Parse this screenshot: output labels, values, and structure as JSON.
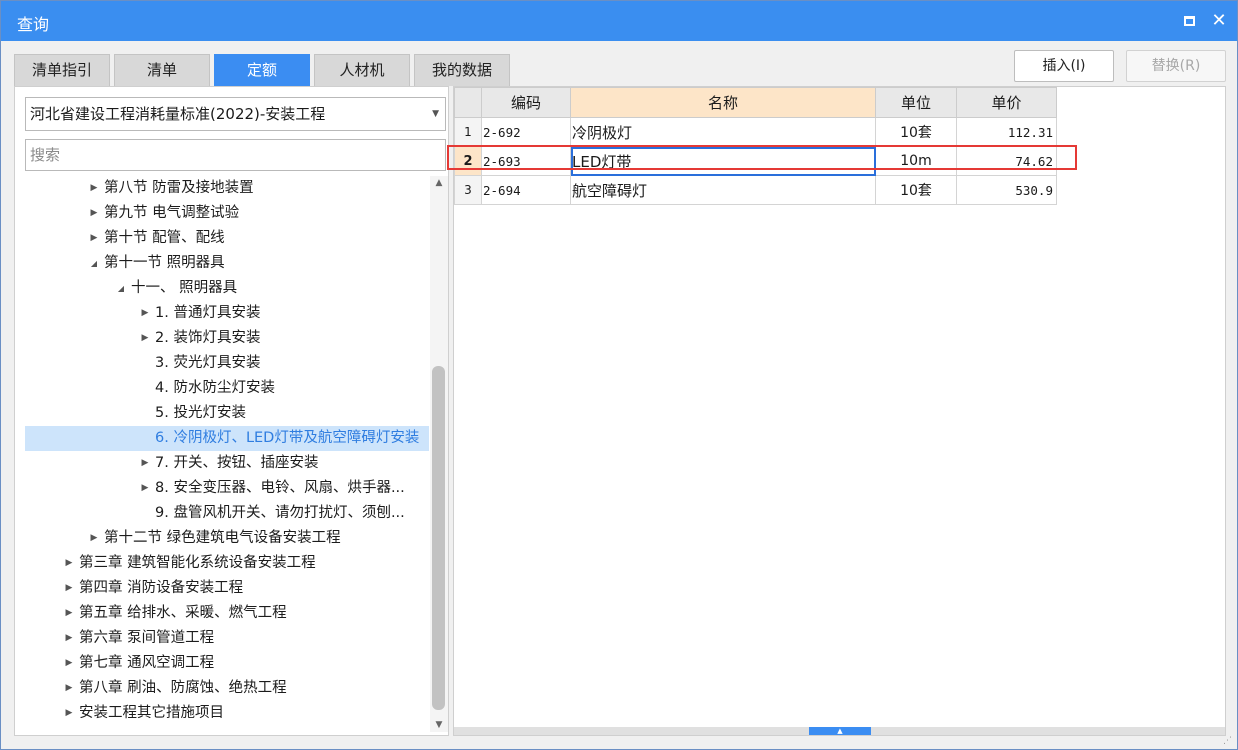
{
  "window": {
    "title": "查询"
  },
  "tabs": [
    {
      "label": "清单指引",
      "active": false
    },
    {
      "label": "清单",
      "active": false
    },
    {
      "label": "定额",
      "active": true
    },
    {
      "label": "人材机",
      "active": false
    },
    {
      "label": "我的数据",
      "active": false
    }
  ],
  "buttons": {
    "insert": "插入(I)",
    "replace": "替换(R)"
  },
  "left": {
    "dropdown_value": "河北省建设工程消耗量标准(2022)-安装工程",
    "search_placeholder": "搜索"
  },
  "tree": [
    {
      "label": "第八节 防雷及接地装置",
      "level": 2,
      "state": "collapsed"
    },
    {
      "label": "第九节 电气调整试验",
      "level": 2,
      "state": "collapsed"
    },
    {
      "label": "第十节 配管、配线",
      "level": 2,
      "state": "collapsed"
    },
    {
      "label": "第十一节 照明器具",
      "level": 2,
      "state": "expanded"
    },
    {
      "label": "十一、 照明器具",
      "level": 3,
      "state": "expanded"
    },
    {
      "label": "1. 普通灯具安装",
      "level": 4,
      "state": "collapsed"
    },
    {
      "label": "2. 装饰灯具安装",
      "level": 4,
      "state": "collapsed"
    },
    {
      "label": "3. 荧光灯具安装",
      "level": 4,
      "state": "leaf"
    },
    {
      "label": "4. 防水防尘灯安装",
      "level": 4,
      "state": "leaf"
    },
    {
      "label": "5. 投光灯安装",
      "level": 4,
      "state": "leaf"
    },
    {
      "label": "6. 冷阴极灯、LED灯带及航空障碍灯安装",
      "level": 4,
      "state": "leaf",
      "selected": true
    },
    {
      "label": "7. 开关、按钮、插座安装",
      "level": 4,
      "state": "collapsed"
    },
    {
      "label": "8. 安全变压器、电铃、风扇、烘手器...",
      "level": 4,
      "state": "collapsed"
    },
    {
      "label": "9. 盘管风机开关、请勿打扰灯、须刨...",
      "level": 4,
      "state": "leaf"
    },
    {
      "label": "第十二节 绿色建筑电气设备安装工程",
      "level": 2,
      "state": "collapsed"
    },
    {
      "label": "第三章 建筑智能化系统设备安装工程",
      "level": 1,
      "state": "collapsed"
    },
    {
      "label": "第四章 消防设备安装工程",
      "level": 1,
      "state": "collapsed"
    },
    {
      "label": "第五章 给排水、采暖、燃气工程",
      "level": 1,
      "state": "collapsed"
    },
    {
      "label": "第六章 泵间管道工程",
      "level": 1,
      "state": "collapsed"
    },
    {
      "label": "第七章 通风空调工程",
      "level": 1,
      "state": "collapsed"
    },
    {
      "label": "第八章 刷油、防腐蚀、绝热工程",
      "level": 1,
      "state": "collapsed"
    },
    {
      "label": "安装工程其它措施项目",
      "level": 1,
      "state": "collapsed"
    }
  ],
  "grid": {
    "headers": {
      "code": "编码",
      "name": "名称",
      "unit": "单位",
      "price": "单价"
    },
    "rows": [
      {
        "num": "1",
        "code": "2-692",
        "name": "冷阴极灯",
        "unit": "10套",
        "price": "112.31"
      },
      {
        "num": "2",
        "code": "2-693",
        "name": "LED灯带",
        "unit": "10m",
        "price": "74.62"
      },
      {
        "num": "3",
        "code": "2-694",
        "name": "航空障碍灯",
        "unit": "10套",
        "price": "530.9"
      }
    ]
  },
  "colors": {
    "accent": "#3b8df2",
    "highlight_box": "#e53935",
    "selected_row": "#cde4fb",
    "header_highlight": "#fde5c8"
  },
  "icons": {
    "close": "close-icon",
    "restore": "restore-icon",
    "dropdown": "chevron-down-icon"
  }
}
